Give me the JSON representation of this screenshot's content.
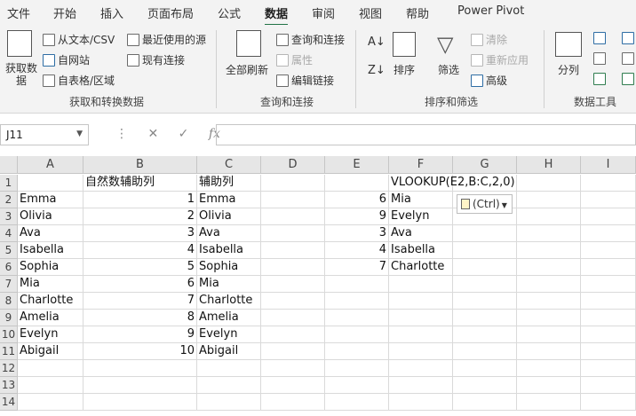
{
  "menu": {
    "tabs": [
      "文件",
      "开始",
      "插入",
      "页面布局",
      "公式",
      "数据",
      "审阅",
      "视图",
      "帮助",
      "Power Pivot"
    ],
    "active": "数据"
  },
  "ribbon": {
    "get_data": {
      "label": "获取数据",
      "from_text_csv": "从文本/CSV",
      "from_web": "自网站",
      "from_table": "自表格/区域",
      "recent_sources": "最近使用的源",
      "existing_connections": "现有连接",
      "group_label": "获取和转换数据"
    },
    "queries": {
      "refresh_all": "全部刷新",
      "queries_connections": "查询和连接",
      "properties": "属性",
      "edit_links": "编辑链接",
      "group_label": "查询和连接"
    },
    "sort_filter": {
      "sort": "排序",
      "filter": "筛选",
      "clear": "清除",
      "reapply": "重新应用",
      "advanced": "高级",
      "group_label": "排序和筛选"
    },
    "data_tools": {
      "text_to_columns": "分列",
      "group_label": "数据工具"
    }
  },
  "formula_bar": {
    "name_box": "J11",
    "fx": "fx",
    "formula": ""
  },
  "sheet": {
    "columns": [
      "A",
      "B",
      "C",
      "D",
      "E",
      "F",
      "G",
      "H",
      "I"
    ],
    "rows": [
      "1",
      "2",
      "3",
      "4",
      "5",
      "6",
      "7",
      "8",
      "9",
      "10",
      "11",
      "12",
      "13",
      "14"
    ],
    "A": [
      "",
      "Emma",
      "Olivia",
      "Ava",
      "Isabella",
      "Sophia",
      "Mia",
      "Charlotte",
      "Amelia",
      "Evelyn",
      "Abigail"
    ],
    "B": [
      "自然数辅助列",
      "1",
      "2",
      "3",
      "4",
      "5",
      "6",
      "7",
      "8",
      "9",
      "10"
    ],
    "C": [
      "辅助列",
      "Emma",
      "Olivia",
      "Ava",
      "Isabella",
      "Sophia",
      "Mia",
      "Charlotte",
      "Amelia",
      "Evelyn",
      "Abigail"
    ],
    "E": [
      "",
      "6",
      "9",
      "3",
      "4",
      "7"
    ],
    "F": [
      "VLOOKUP(E2,B:C,2,0)",
      "Mia",
      "Evelyn",
      "Ava",
      "Isabella",
      "Charlotte"
    ],
    "paste_options": "(Ctrl)"
  }
}
